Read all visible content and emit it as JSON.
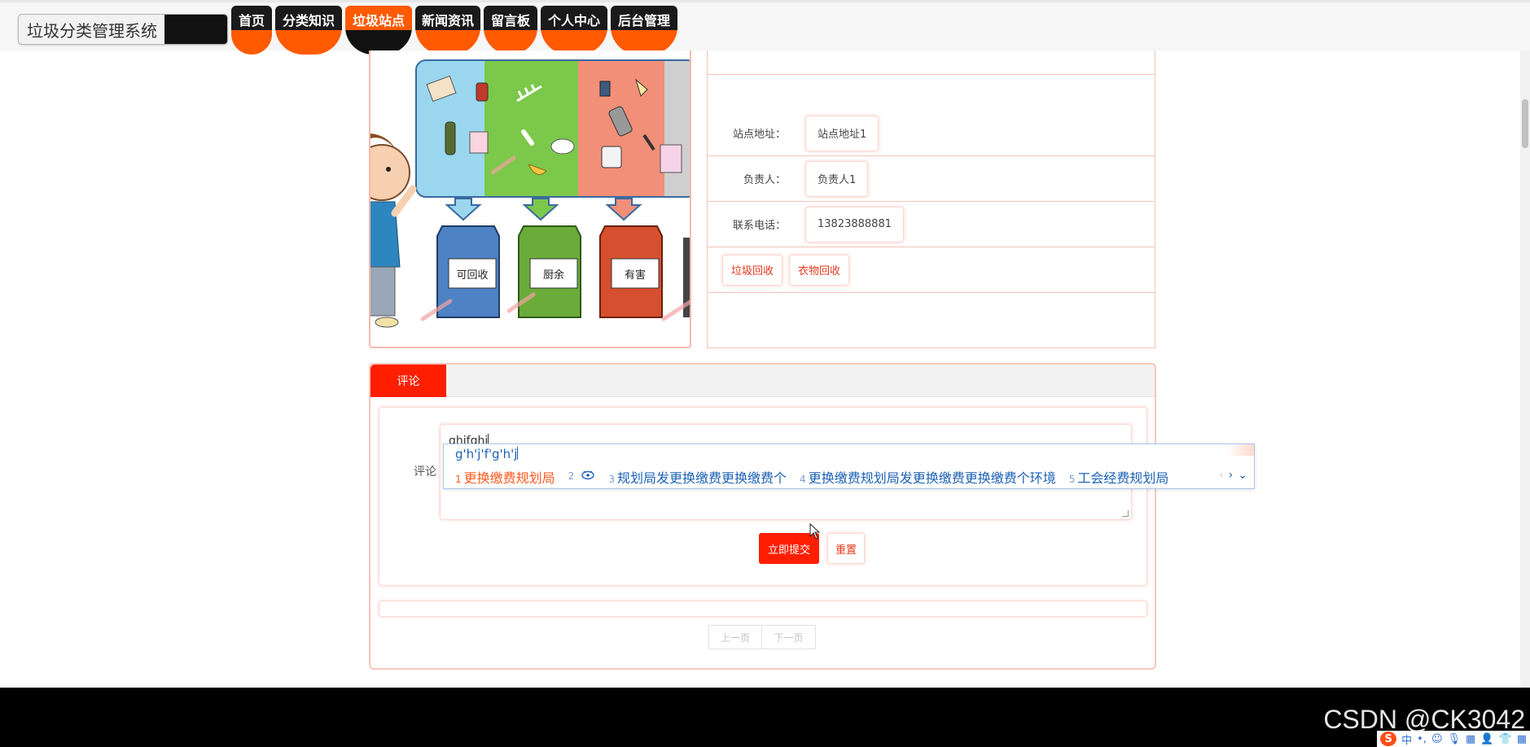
{
  "site": {
    "title": "垃圾分类管理系统"
  },
  "nav": {
    "items": [
      {
        "label": "首页"
      },
      {
        "label": "分类知识"
      },
      {
        "label": "垃圾站点",
        "active": true
      },
      {
        "label": "新闻资讯"
      },
      {
        "label": "留言板"
      },
      {
        "label": "个人中心"
      },
      {
        "label": "后台管理"
      }
    ]
  },
  "station": {
    "address_label": "站点地址：",
    "address": "站点地址1",
    "manager_label": "负责人：",
    "manager": "负责人1",
    "phone_label": "联系电话：",
    "phone": "13823888881",
    "actions": [
      "垃圾回收",
      "衣物回收"
    ],
    "image_bin_labels": [
      "可回收",
      "厨余",
      "有害"
    ]
  },
  "comment": {
    "tab_label": "评论",
    "field_label": "评论",
    "text": "ghjfghj",
    "submit_label": "立即提交",
    "reset_label": "重置"
  },
  "pager": {
    "prev": "上一页",
    "next": "下一页"
  },
  "ime": {
    "composition": "g'h'j'f'g'h'j",
    "candidates": [
      {
        "n": "1",
        "text": "更换缴费规划局"
      },
      {
        "n": "2",
        "text": ""
      },
      {
        "n": "3",
        "text": "规划局发更换缴费更换缴费个"
      },
      {
        "n": "4",
        "text": "更换缴费规划局发更换缴费更换缴费个环境"
      },
      {
        "n": "5",
        "text": "工会经费规划局"
      }
    ]
  },
  "watermark": "CSDN @CK3042",
  "tray": {
    "lang": "中"
  },
  "colors": {
    "accent": "#ff5a00",
    "primary": "#ff1e00",
    "border": "#f6b9ad"
  }
}
